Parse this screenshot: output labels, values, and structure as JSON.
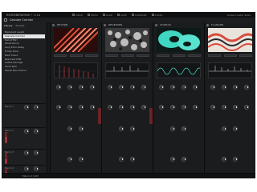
{
  "app": {
    "title": "REVERBERATING • 1:14",
    "menu": [
      "UNDO",
      "REDO",
      "LOAD",
      "SAVE",
      "COMPARE",
      "CLEAR"
    ],
    "right_info": "Global Loader 4094"
  },
  "preset": {
    "name": "Cascade Corridor"
  },
  "sidebar": {
    "tabs": [
      "Library",
      "Presets"
    ],
    "items": [
      "Big board reverb",
      "Cascade Corridor",
      "Hall of Mirr",
      "Ghost Room",
      "Long Echo Delay",
      "Frosty Zone",
      "Dark Cloud",
      "Resonant Mist",
      "Subtle Damage",
      "Vocal Spill",
      "Words Plus Chorus"
    ],
    "sections": [
      {
        "label": "Macro 1"
      },
      {
        "label": "Macro 2"
      },
      {
        "label": "Macro 3"
      },
      {
        "label": "Macro 4"
      }
    ]
  },
  "effects": [
    {
      "name": "REVERB",
      "mode": "Hall",
      "art": "stripes"
    },
    {
      "name": "REVERSER",
      "mode": "Tape",
      "art": "noise"
    },
    {
      "name": "CHORUS",
      "mode": "Wide",
      "art": "blobs"
    },
    {
      "name": "FLANGER",
      "mode": "Jet",
      "art": "waves"
    }
  ],
  "footer": {
    "label": "Macro 4  0.00"
  }
}
